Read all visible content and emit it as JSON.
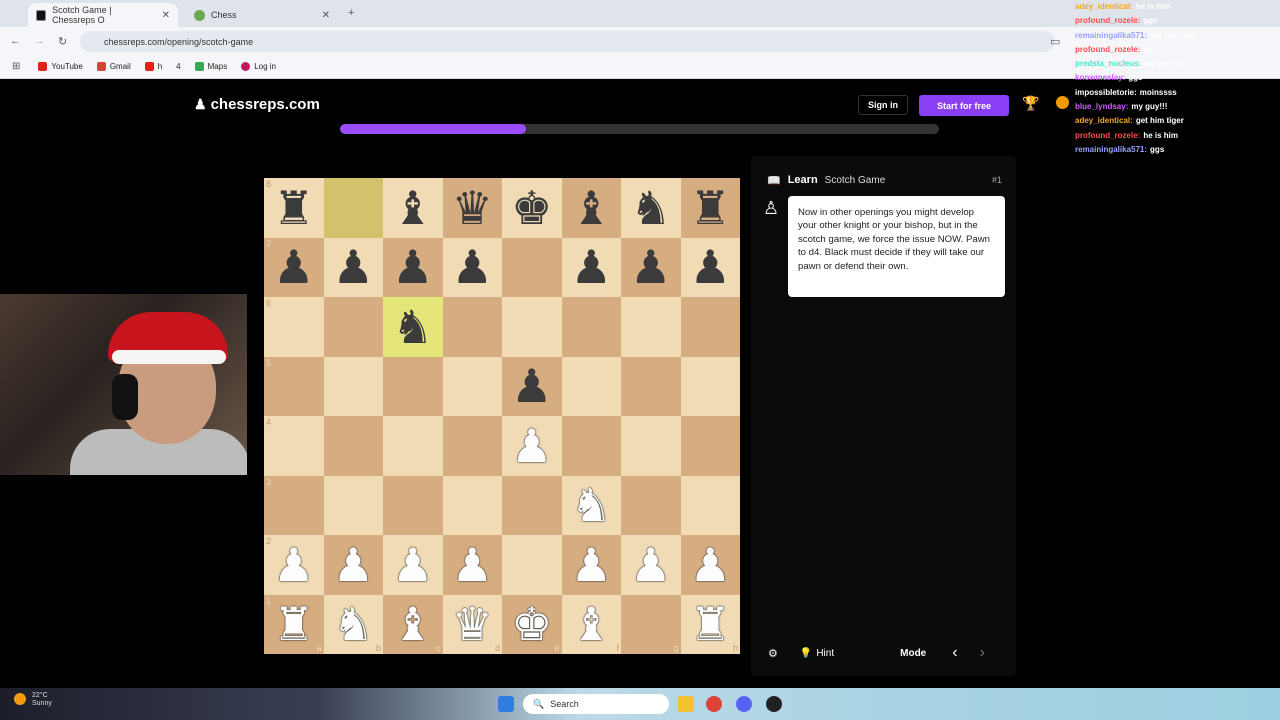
{
  "browser": {
    "tabs": [
      {
        "title": "Scotch Game | Chessreps O",
        "active": true
      },
      {
        "title": "Chess",
        "active": false
      }
    ],
    "url": "chessreps.com/opening/scotch-game",
    "bookmarks": [
      "YouTube",
      "Gmail",
      "h",
      "4",
      "Maps",
      "Log in"
    ]
  },
  "site": {
    "logo": "chessreps.com",
    "signin": "Sign in",
    "start": "Start for free",
    "progress_fraction": 0.31
  },
  "board": {
    "ranks": [
      "8",
      "7",
      "6",
      "5",
      "4",
      "3",
      "2",
      "1"
    ],
    "files": [
      "a",
      "b",
      "c",
      "d",
      "e",
      "f",
      "g",
      "h"
    ],
    "position": [
      [
        "r",
        "",
        "b",
        "q",
        "k",
        "b",
        "n",
        "r"
      ],
      [
        "p",
        "p",
        "p",
        "p",
        "",
        "p",
        "p",
        "p"
      ],
      [
        "",
        "",
        "n",
        "",
        "",
        "",
        "",
        ""
      ],
      [
        "",
        "",
        "",
        "",
        "p",
        "",
        "",
        ""
      ],
      [
        "",
        "",
        "",
        "",
        "P",
        "",
        "",
        ""
      ],
      [
        "",
        "",
        "",
        "",
        "",
        "N",
        "",
        ""
      ],
      [
        "P",
        "P",
        "P",
        "P",
        "",
        "P",
        "P",
        "P"
      ],
      [
        "R",
        "N",
        "B",
        "Q",
        "K",
        "B",
        "",
        "R"
      ]
    ],
    "highlight": [
      "b8",
      "c6"
    ]
  },
  "learn": {
    "title": "Learn",
    "opening": "Scotch Game",
    "number": "#1",
    "text": "Now in other openings you might develop your other knight or your bishop, but in the scotch game, we force the issue NOW. Pawn to d4. Black must decide if they will take our pawn or defend their own.",
    "hint": "Hint",
    "mode": "Mode"
  },
  "chat": [
    {
      "user": "adey_identical:",
      "msg": "he is him",
      "color": "#f5a623"
    },
    {
      "user": "profound_rozele:",
      "msg": "ggs",
      "color": "#ff4d4d"
    },
    {
      "user": "remainingalika571:",
      "msg": "get him tiger",
      "color": "#9aa0ff"
    },
    {
      "user": "profound_rozele:",
      "msg": "wh...",
      "color": "#ff4d4d"
    },
    {
      "user": "predsta_nucleus:",
      "msg": "my guy!!!",
      "color": "#4de6c8"
    },
    {
      "user": "knowmeslay:",
      "msg": "ggs",
      "color": "#d45bff"
    },
    {
      "user": "impossibletorie:",
      "msg": "moinssss",
      "color": "#ffffff"
    },
    {
      "user": "blue_lyndsay:",
      "msg": "my guy!!!",
      "color": "#d45bff"
    },
    {
      "user": "adey_identical:",
      "msg": "get him tiger",
      "color": "#f5a623"
    },
    {
      "user": "profound_rozele:",
      "msg": "he is him",
      "color": "#ff4d4d"
    },
    {
      "user": "remainingalika571:",
      "msg": "ggs",
      "color": "#9aa0ff"
    }
  ],
  "taskbar": {
    "weather": "22°C",
    "weather_sub": "Sunny",
    "search": "Search"
  }
}
